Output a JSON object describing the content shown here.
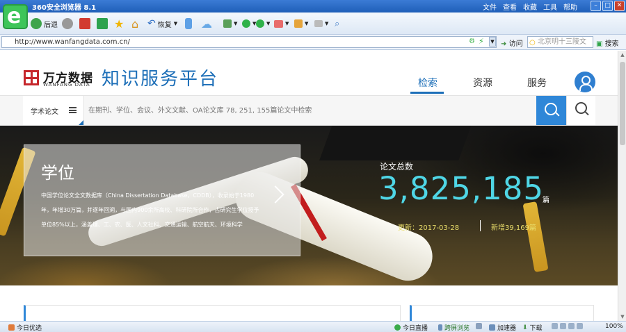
{
  "browser": {
    "title": "360安全浏览器 8.1",
    "menus": [
      "文件",
      "查看",
      "收藏",
      "工具",
      "帮助"
    ],
    "toolbar": {
      "back": "后退",
      "restore": "恢复"
    },
    "url": "http://www.wanfangdata.com.cn/",
    "visit": "访问",
    "search_placeholder": "北京明十三陵文",
    "search": "搜索",
    "status": {
      "left": "今日优选",
      "live": "今日直播",
      "cross_screen": "跨屏浏览",
      "accelerator": "加速器",
      "download": "下载",
      "zoom": "100%"
    }
  },
  "site": {
    "brand_cn": "万方数据",
    "brand_en": "WANFANG DATA",
    "platform": "知识服务平台",
    "nav": [
      "检索",
      "资源",
      "服务"
    ],
    "search_type": "学术论文",
    "search_placeholder": "在期刊、学位、会议、外文文献、OA论文库 78, 251, 155篇论文中检索"
  },
  "hero": {
    "title": "学位",
    "description": "中国学位论文全文数据库（China Dissertation Database，CDDB），收录始于1980年，年增30万篇，并逐年回溯，与国内900余所高校、科研院所合作，占研究生学位授予单位85%以上，涵盖理、工、农、医、人文社科、交通运输、航空航天、环境科学",
    "stat_label": "论文总数",
    "stat_value": "3,825,185",
    "stat_unit": "篇",
    "update": "更新：2017-03-28",
    "new_count": "新增39,169篇"
  },
  "colors": {
    "brand_blue": "#1d6fb8",
    "brand_red": "#c6262b",
    "stat_cyan": "#4fd6e6"
  }
}
